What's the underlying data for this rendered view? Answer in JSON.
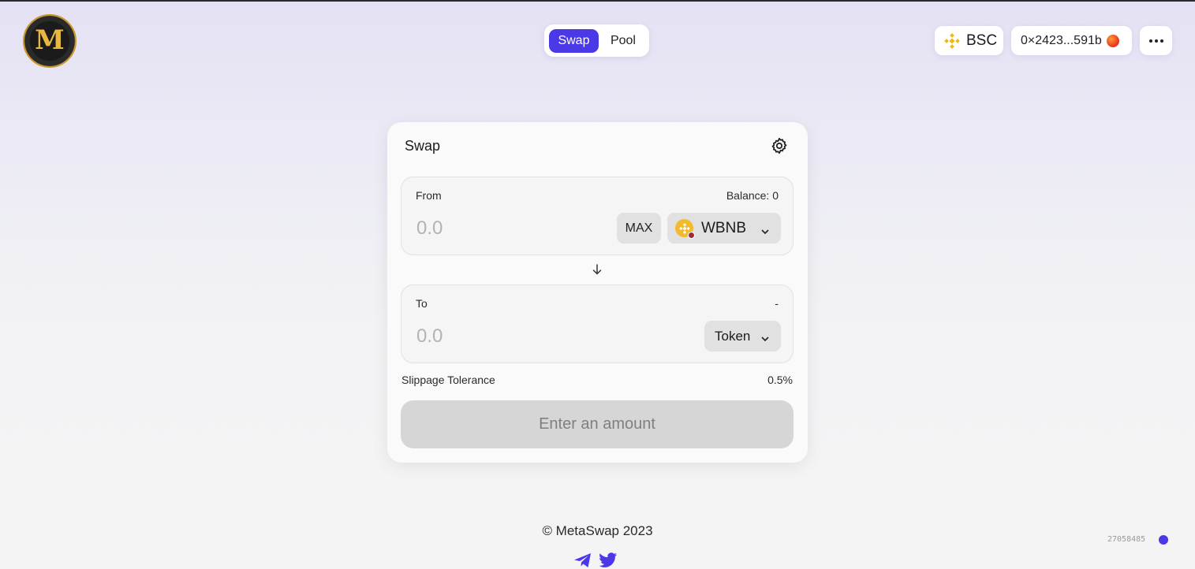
{
  "brand": {
    "logo_letter": "M"
  },
  "nav": {
    "swap": "Swap",
    "pool": "Pool",
    "active": "Swap"
  },
  "header": {
    "network": "BSC",
    "account": "0×2423...591b",
    "more_icon": "more-dots-icon"
  },
  "swap_card": {
    "title": "Swap",
    "settings_icon": "gear-icon",
    "from": {
      "label": "From",
      "balance": "Balance: 0",
      "amount_placeholder": "0.0",
      "max_label": "MAX",
      "token": "WBNB"
    },
    "to": {
      "label": "To",
      "balance": "-",
      "amount_placeholder": "0.0",
      "token": "Token"
    },
    "slippage_label": "Slippage Tolerance",
    "slippage_value": "0.5%",
    "cta_label": "Enter an amount"
  },
  "footer": {
    "copyright": "© MetaSwap 2023",
    "social_icons": [
      "telegram-icon",
      "twitter-icon"
    ],
    "block_number": "27058485"
  },
  "colors": {
    "accent": "#4b39e8",
    "bnb": "#f3ba2f"
  }
}
